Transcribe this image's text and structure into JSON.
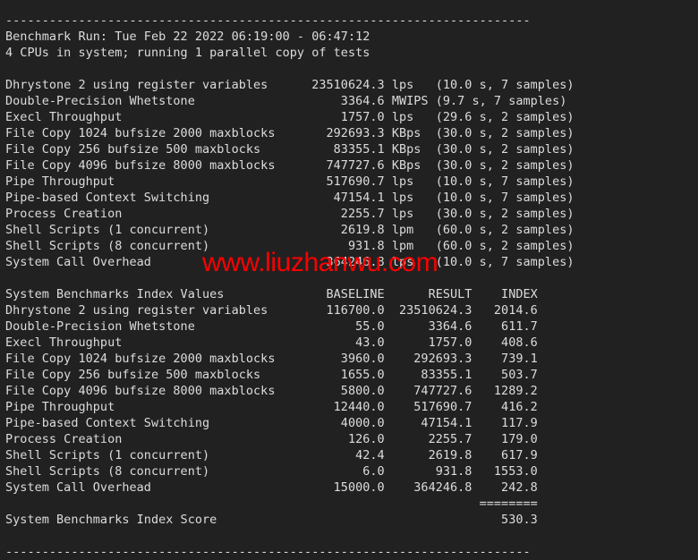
{
  "terminal": {
    "background_color": "#212121",
    "text_color": "#dcdcdc",
    "watermark_color": "#fc0000",
    "top_rule": "------------------------------------------------------------------------",
    "bottom_rule": "------------------------------------------------------------------------",
    "header": {
      "run_line": "Benchmark Run: Tue Feb 22 2022 06:19:00 - 06:47:12",
      "cpu_line": "4 CPUs in system; running 1 parallel copy of tests"
    },
    "results_block": [
      {
        "test": "Dhrystone 2 using register variables",
        "value": "23510624.3",
        "unit": "lps",
        "timing": "(10.0 s, 7 samples)"
      },
      {
        "test": "Double-Precision Whetstone",
        "value": "3364.6",
        "unit": "MWIPS",
        "timing": "(9.7 s, 7 samples)"
      },
      {
        "test": "Execl Throughput",
        "value": "1757.0",
        "unit": "lps",
        "timing": "(29.6 s, 2 samples)"
      },
      {
        "test": "File Copy 1024 bufsize 2000 maxblocks",
        "value": "292693.3",
        "unit": "KBps",
        "timing": "(30.0 s, 2 samples)"
      },
      {
        "test": "File Copy 256 bufsize 500 maxblocks",
        "value": "83355.1",
        "unit": "KBps",
        "timing": "(30.0 s, 2 samples)"
      },
      {
        "test": "File Copy 4096 bufsize 8000 maxblocks",
        "value": "747727.6",
        "unit": "KBps",
        "timing": "(30.0 s, 2 samples)"
      },
      {
        "test": "Pipe Throughput",
        "value": "517690.7",
        "unit": "lps",
        "timing": "(10.0 s, 7 samples)"
      },
      {
        "test": "Pipe-based Context Switching",
        "value": "47154.1",
        "unit": "lps",
        "timing": "(10.0 s, 7 samples)"
      },
      {
        "test": "Process Creation",
        "value": "2255.7",
        "unit": "lps",
        "timing": "(30.0 s, 2 samples)"
      },
      {
        "test": "Shell Scripts (1 concurrent)",
        "value": "2619.8",
        "unit": "lpm",
        "timing": "(60.0 s, 2 samples)"
      },
      {
        "test": "Shell Scripts (8 concurrent)",
        "value": "931.8",
        "unit": "lpm",
        "timing": "(60.0 s, 2 samples)"
      },
      {
        "test": "System Call Overhead",
        "value": "364246.8",
        "unit": "lps",
        "timing": "(10.0 s, 7 samples)"
      }
    ],
    "index_block": {
      "title": "System Benchmarks Index Values",
      "columns": [
        "BASELINE",
        "RESULT",
        "INDEX"
      ],
      "rows": [
        {
          "test": "Dhrystone 2 using register variables",
          "baseline": "116700.0",
          "result": "23510624.3",
          "index": "2014.6"
        },
        {
          "test": "Double-Precision Whetstone",
          "baseline": "55.0",
          "result": "3364.6",
          "index": "611.7"
        },
        {
          "test": "Execl Throughput",
          "baseline": "43.0",
          "result": "1757.0",
          "index": "408.6"
        },
        {
          "test": "File Copy 1024 bufsize 2000 maxblocks",
          "baseline": "3960.0",
          "result": "292693.3",
          "index": "739.1"
        },
        {
          "test": "File Copy 256 bufsize 500 maxblocks",
          "baseline": "1655.0",
          "result": "83355.1",
          "index": "503.7"
        },
        {
          "test": "File Copy 4096 bufsize 8000 maxblocks",
          "baseline": "5800.0",
          "result": "747727.6",
          "index": "1289.2"
        },
        {
          "test": "Pipe Throughput",
          "baseline": "12440.0",
          "result": "517690.7",
          "index": "416.2"
        },
        {
          "test": "Pipe-based Context Switching",
          "baseline": "4000.0",
          "result": "47154.1",
          "index": "117.9"
        },
        {
          "test": "Process Creation",
          "baseline": "126.0",
          "result": "2255.7",
          "index": "179.0"
        },
        {
          "test": "Shell Scripts (1 concurrent)",
          "baseline": "42.4",
          "result": "2619.8",
          "index": "617.9"
        },
        {
          "test": "Shell Scripts (8 concurrent)",
          "baseline": "6.0",
          "result": "931.8",
          "index": "1553.0"
        },
        {
          "test": "System Call Overhead",
          "baseline": "15000.0",
          "result": "364246.8",
          "index": "242.8"
        }
      ],
      "score_separator": "========",
      "score_label": "System Benchmarks Index Score",
      "score_value": "530.3"
    },
    "watermark": "www.liuzhanwu.com"
  }
}
